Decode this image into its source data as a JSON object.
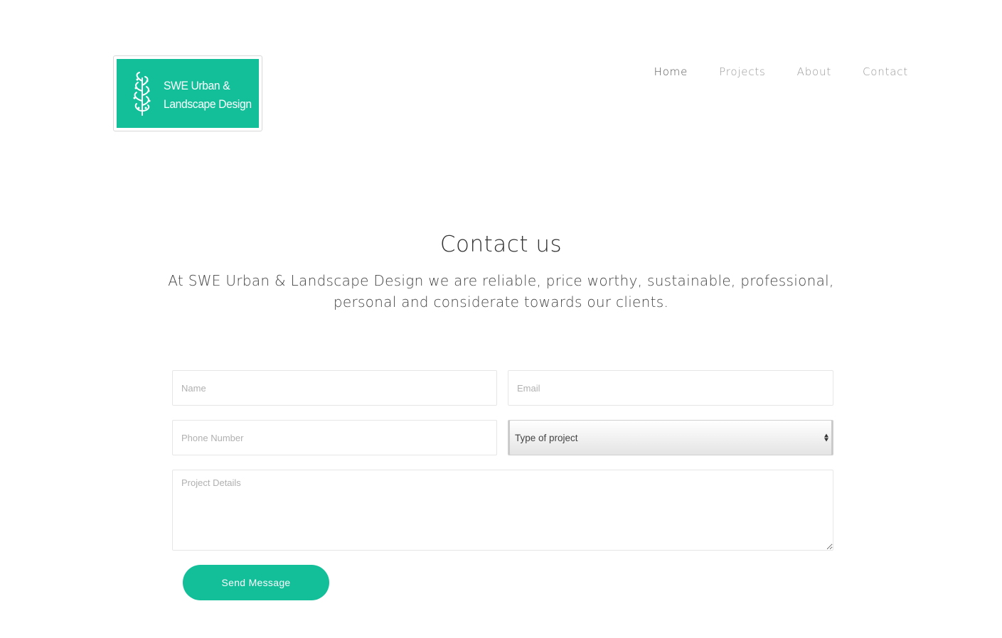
{
  "brand": {
    "line1": "SWE Urban &",
    "line2": "Landscape Design",
    "color": "#13bf99",
    "icon": "leaf-tree-icon"
  },
  "nav": {
    "items": [
      {
        "label": "Home",
        "active": true
      },
      {
        "label": "Projects",
        "active": false
      },
      {
        "label": "About",
        "active": false
      },
      {
        "label": "Contact",
        "active": false
      }
    ]
  },
  "hero": {
    "title": "Contact us",
    "subtitle": "At SWE Urban & Landscape Design we are reliable, price worthy, sustainable, professional, personal and considerate towards our clients."
  },
  "form": {
    "name_placeholder": "Name",
    "email_placeholder": "Email",
    "phone_placeholder": "Phone Number",
    "project_type_selected": "Type of project",
    "details_placeholder": "Project Details",
    "submit_label": "Send Message"
  }
}
